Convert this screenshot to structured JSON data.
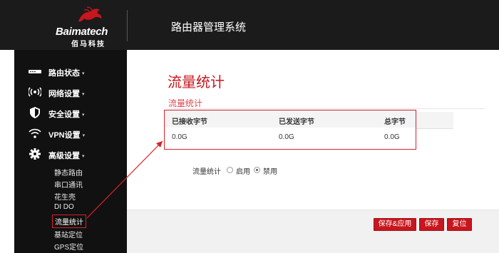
{
  "header": {
    "brand": "Baimatech",
    "brand_sub": "佰马科技",
    "title": "路由器管理系统"
  },
  "sidebar": {
    "items": [
      {
        "label": "路由状态",
        "icon": "router-status-icon"
      },
      {
        "label": "网络设置",
        "icon": "network-icon"
      },
      {
        "label": "安全设置",
        "icon": "shield-icon"
      },
      {
        "label": "VPN设置",
        "icon": "vpn-icon"
      },
      {
        "label": "高级设置",
        "icon": "gear-icon"
      }
    ],
    "caret": "▾",
    "subitems": [
      "静态路由",
      "串口通讯",
      "花生壳",
      "DI DO",
      "流量统计",
      "基站定位",
      "GPS定位"
    ],
    "active_subitem": "流量统计"
  },
  "main": {
    "page_title": "流量统计",
    "section_title": "流量统计",
    "table": {
      "headers": [
        "已接收字节",
        "已发送字节",
        "总字节"
      ],
      "values": [
        "0.0G",
        "0.0G",
        "0.0G"
      ]
    },
    "toggle": {
      "label": "流量统计",
      "options": [
        "启用",
        "禁用"
      ],
      "selected": "禁用"
    },
    "buttons": {
      "save_apply": "保存&应用",
      "save": "保存",
      "reset": "复位"
    }
  },
  "colors": {
    "accent": "#c8161e",
    "highlight_border": "#d9202a",
    "header_bg": "#1b1b1b",
    "sidebar_bg": "#111111"
  }
}
